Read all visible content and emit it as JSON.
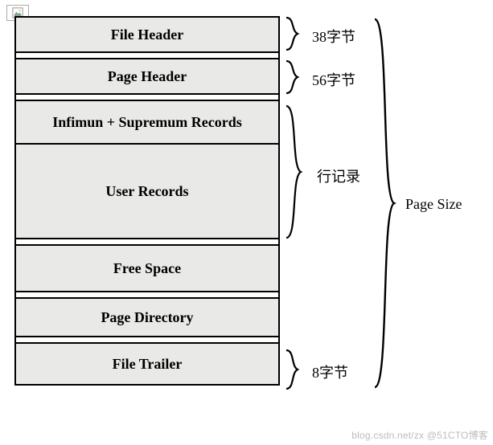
{
  "sections": {
    "fileHeader": "File Header",
    "pageHeader": "Page Header",
    "infSup": "Infimun + Supremum Records",
    "userRecords": "User Records",
    "freeSpace": "Free Space",
    "pageDirectory": "Page Directory",
    "fileTrailer": "File Trailer"
  },
  "labels": {
    "fileHeaderSize": "38字节",
    "pageHeaderSize": "56字节",
    "rowRecords": "行记录",
    "fileTrailerSize": "8字节",
    "pageSize": "Page Size"
  },
  "watermark": "blog.csdn.net/zx @51CTO博客",
  "chart_data": {
    "type": "table",
    "title": "InnoDB Page Structure",
    "rows": [
      {
        "section": "File Header",
        "size": "38字节"
      },
      {
        "section": "Page Header",
        "size": "56字节"
      },
      {
        "section": "Infimun + Supremum Records",
        "group": "行记录"
      },
      {
        "section": "User Records",
        "group": "行记录"
      },
      {
        "section": "Free Space"
      },
      {
        "section": "Page Directory"
      },
      {
        "section": "File Trailer",
        "size": "8字节"
      }
    ],
    "overall": "Page Size"
  }
}
